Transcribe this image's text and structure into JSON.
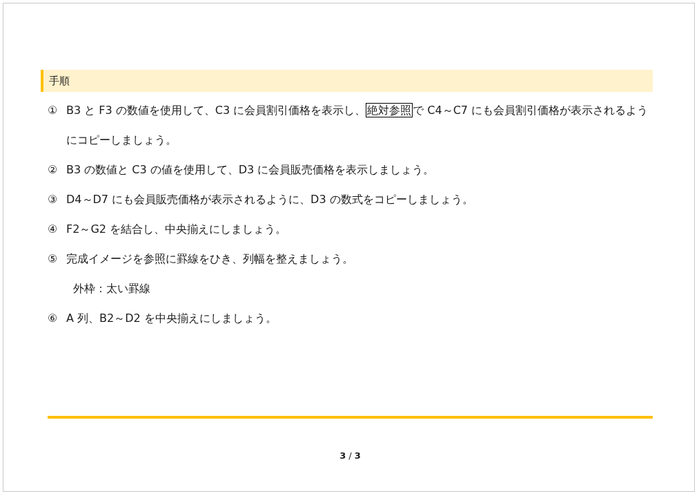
{
  "heading": "手順",
  "steps": [
    {
      "number": "①",
      "segments": [
        {
          "text": "B3 と F3 の数値を使用して、C3 に会員割引価格を表示し、",
          "boxed": false
        },
        {
          "text": "絶対参照",
          "boxed": true
        },
        {
          "text": "で C4～C7 にも会員割引価格が表示されるようにコピーしましょう。",
          "boxed": false
        }
      ]
    },
    {
      "number": "②",
      "segments": [
        {
          "text": "B3 の数値と C3 の値を使用して、D3 に会員販売価格を表示しましょう。",
          "boxed": false
        }
      ]
    },
    {
      "number": "③",
      "segments": [
        {
          "text": "D4～D7 にも会員販売価格が表示されるように、D3 の数式をコピーしましょう。",
          "boxed": false
        }
      ]
    },
    {
      "number": "④",
      "segments": [
        {
          "text": "F2～G2 を結合し、中央揃えにしましょう。",
          "boxed": false
        }
      ]
    },
    {
      "number": "⑤",
      "segments": [
        {
          "text": "完成イメージを参照に罫線をひき、列幅を整えましょう。",
          "boxed": false
        }
      ],
      "note": "外枠：太い罫線"
    },
    {
      "number": "⑥",
      "segments": [
        {
          "text": "A 列、B2～D2 を中央揃えにしましょう。",
          "boxed": false
        }
      ]
    }
  ],
  "page_number": "**3** / **3**"
}
